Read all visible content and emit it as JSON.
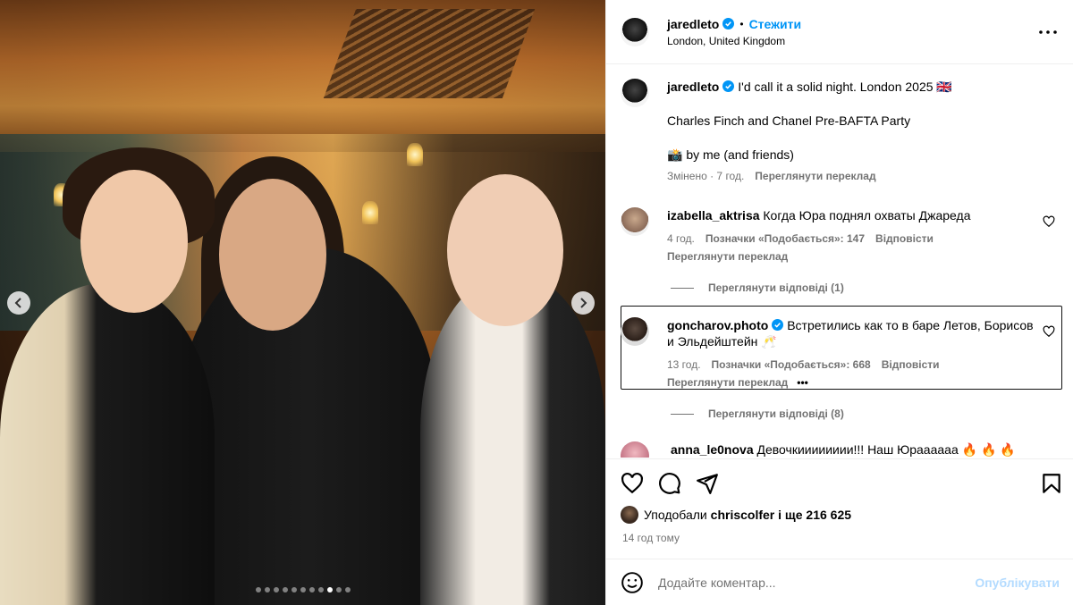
{
  "post": {
    "username": "jaredleto",
    "follow_label": "Стежити",
    "location": "London, United Kingdom",
    "more_icon": "more-horizontal-icon",
    "carousel": {
      "total_slides": 11,
      "active_slide": 9
    }
  },
  "caption": {
    "username": "jaredleto",
    "line1": "I'd call it a solid night. London 2025 🇬🇧",
    "line2": "Charles Finch and Chanel Pre-BAFTA Party",
    "line3": "📸 by me (and friends)",
    "edited": "Змінено · 7 год.",
    "translate": "Переглянути переклад"
  },
  "comments": [
    {
      "username": "izabella_aktrisa",
      "text": "Когда Юра поднял охваты Джареда",
      "time": "4 год.",
      "likes": "Позначки «Подобається»: 147",
      "reply": "Відповісти",
      "translate": "Переглянути переклад",
      "replies": "Переглянути відповіді (1)"
    },
    {
      "username": "goncharov.photo",
      "text": "Встретились как то в баре Летов, Борисов и Эльдейштейн 🥂",
      "time": "13 год.",
      "likes": "Позначки «Подобається»: 668",
      "reply": "Відповісти",
      "translate": "Переглянути переклад",
      "more": "•••",
      "replies": "Переглянути відповіді (8)"
    },
    {
      "username": "anna_le0nova",
      "text": "Девочкииииииии!!! Наш Юраааааа 🔥 🔥 🔥"
    }
  ],
  "footer": {
    "liked_prefix": "Уподобали",
    "liked_user": "chriscolfer",
    "liked_suffix": "і ще 216 625",
    "time": "14 год тому",
    "comment_placeholder": "Додайте коментар...",
    "publish_label": "Опублікувати"
  },
  "colors": {
    "accent": "#0095f6",
    "muted": "#737373",
    "publish_disabled": "#b3dbff"
  }
}
